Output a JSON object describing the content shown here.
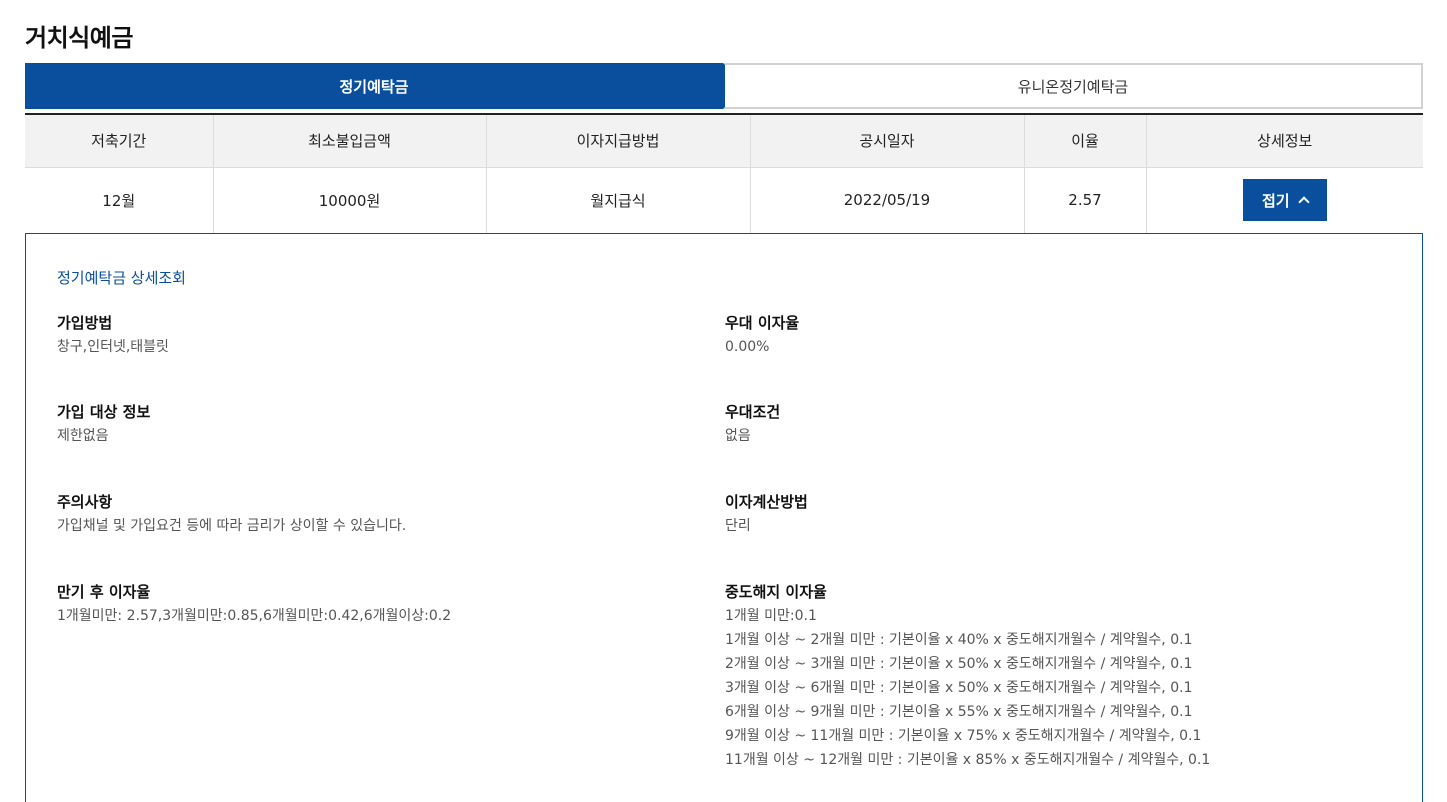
{
  "page_title": "거치식예금",
  "tabs": [
    {
      "label": "정기예탁금",
      "active": true
    },
    {
      "label": "유니온정기예탁금",
      "active": false
    }
  ],
  "table": {
    "headers": [
      "저축기간",
      "최소불입금액",
      "이자지급방법",
      "공시일자",
      "이율",
      "상세정보"
    ],
    "row": {
      "period": "12월",
      "min_amount": "10000원",
      "payment_method": "월지급식",
      "notice_date": "2022/05/19",
      "rate": "2.57",
      "fold_label": "접기"
    }
  },
  "detail": {
    "title": "정기예탁금 상세조회",
    "join_method": {
      "label": "가입방법",
      "value": "창구,인터넷,태블릿"
    },
    "preferential_rate": {
      "label": "우대 이자율",
      "value": "0.00%"
    },
    "eligibility": {
      "label": "가입 대상 정보",
      "value": "제한없음"
    },
    "preferential_condition": {
      "label": "우대조건",
      "value": "없음"
    },
    "caution": {
      "label": "주의사항",
      "value": "가입채널 및 가입요건 등에 따라 금리가 상이할 수 있습니다."
    },
    "calc_method": {
      "label": "이자계산방법",
      "value": "단리"
    },
    "post_maturity": {
      "label": "만기 후 이자율",
      "value": "1개월미만: 2.57,3개월미만:0.85,6개월미만:0.42,6개월이상:0.2"
    },
    "early_termination": {
      "label": "중도해지 이자율",
      "lines": [
        "1개월 미만:0.1",
        "1개월 이상 ~ 2개월 미만 : 기본이율 x 40% x 중도해지개월수 / 계약월수, 0.1",
        "2개월 이상 ~ 3개월 미만 : 기본이율 x 50% x 중도해지개월수 / 계약월수, 0.1",
        "3개월 이상 ~ 6개월 미만 : 기본이율 x 50% x 중도해지개월수 / 계약월수, 0.1",
        "6개월 이상 ~ 9개월 미만 : 기본이율 x 55% x 중도해지개월수 / 계약월수, 0.1",
        "9개월 이상 ~ 11개월 미만 : 기본이율 x 75% x 중도해지개월수 / 계약월수, 0.1",
        "11개월 이상 ~ 12개월 미만 : 기본이율 x 85% x 중도해지개월수 / 계약월수, 0.1"
      ]
    }
  },
  "colors": {
    "brand": "#0a4f9e",
    "header_bg": "#f2f2f2"
  }
}
